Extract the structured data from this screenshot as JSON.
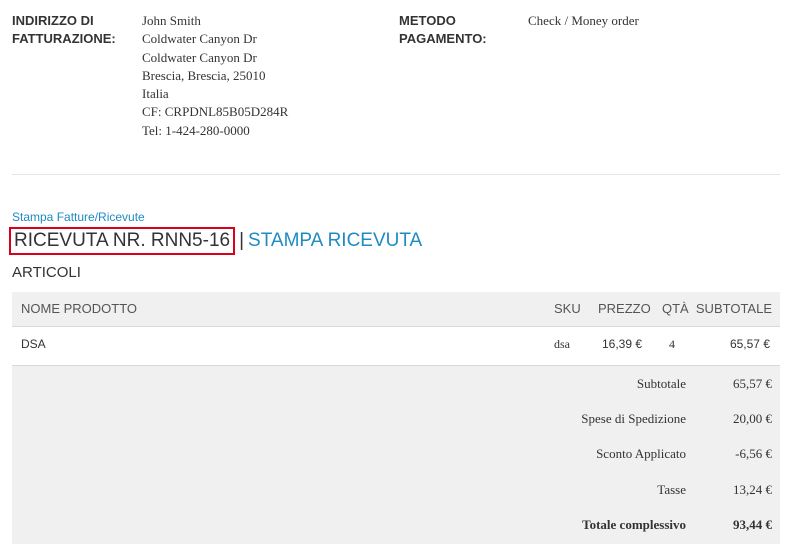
{
  "billing": {
    "label": "INDIRIZZO DI FATTURAZIONE:",
    "lines": [
      "John Smith",
      "Coldwater Canyon Dr",
      "Coldwater Canyon Dr",
      "Brescia, Brescia, 25010",
      "Italia",
      "CF: CRPDNL85B05D284R",
      "Tel: 1-424-280-0000"
    ]
  },
  "payment": {
    "label": "METODO PAGAMENTO:",
    "value": "Check / Money order"
  },
  "print_link": "Stampa Fatture/Ricevute",
  "receipt": {
    "number": "RICEVUTA NR. RNN5-16",
    "separator": "|",
    "print_label": "STAMPA RICEVUTA"
  },
  "articles_title": "ARTICOLI",
  "table": {
    "headers": {
      "name": "NOME PRODOTTO",
      "sku": "SKU",
      "price": "PREZZO",
      "qty": "QTÀ",
      "subtotal": "SUBTOTALE"
    },
    "rows": [
      {
        "name": "DSA",
        "sku": "dsa",
        "price": "16,39 €",
        "qty": "4",
        "subtotal": "65,57 €"
      }
    ]
  },
  "totals": [
    {
      "label": "Subtotale",
      "value": "65,57 €"
    },
    {
      "label": "Spese di Spedizione",
      "value": "20,00 €"
    },
    {
      "label": "Sconto Applicato",
      "value": "-6,56 €"
    },
    {
      "label": "Tasse",
      "value": "13,24 €"
    },
    {
      "label": "Totale complessivo",
      "value": "93,44 €"
    }
  ],
  "colors": {
    "link": "#1e8bc3",
    "highlight_border": "#d9001b",
    "table_background": "#f0f0f0"
  }
}
